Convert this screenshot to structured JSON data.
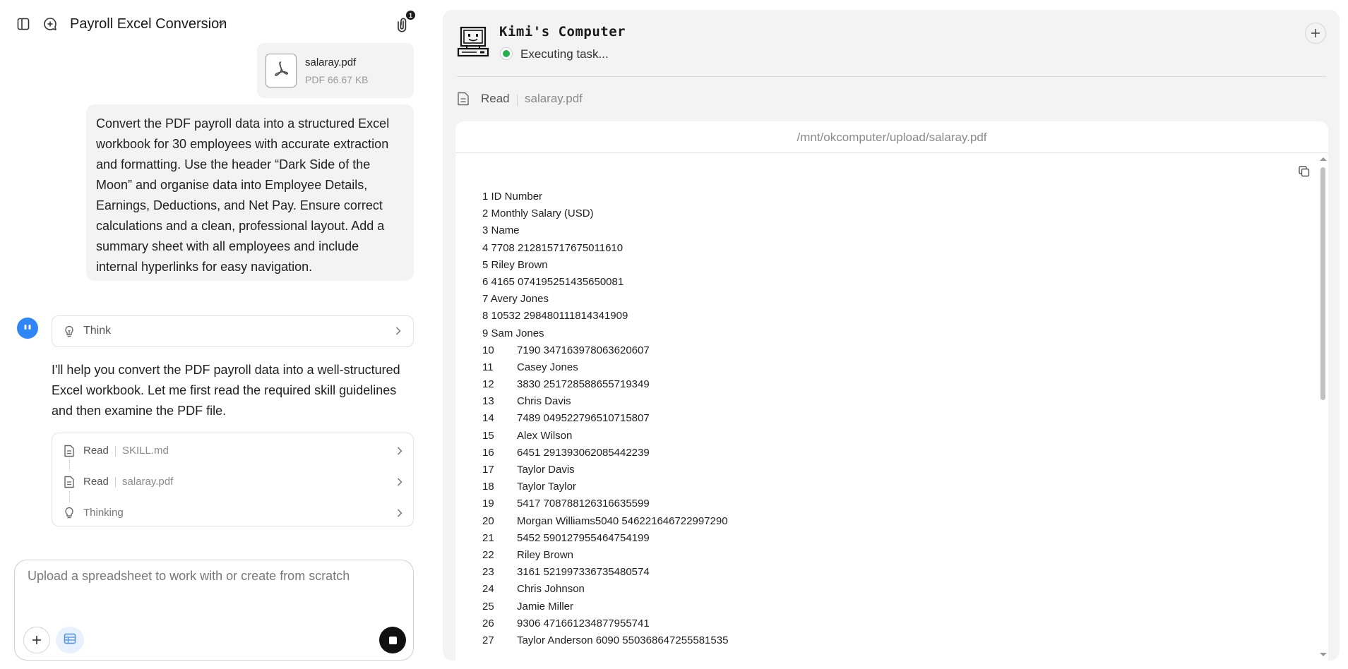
{
  "header": {
    "chat_title": "Payroll Excel Conversion",
    "attachment_count": "1"
  },
  "attachment": {
    "name": "salaray.pdf",
    "meta": "PDF 66.67 KB"
  },
  "user_message": "Convert the PDF payroll data into a structured Excel workbook for 30 employees with accurate extraction and formatting. Use the header “Dark Side of the Moon” and organise data into Employee Details, Earnings, Deductions, and Net Pay. Ensure correct calculations and a clean, professional layout. Add a summary sheet with all employees and include internal hyperlinks for easy navigation.",
  "think": {
    "label": "Think"
  },
  "assistant_message": "I'll help you convert the PDF payroll data into a well-structured Excel workbook. Let me first read the required skill guidelines and then examine the PDF file.",
  "steps": [
    {
      "label": "Read",
      "arg": "SKILL.md"
    },
    {
      "label": "Read",
      "arg": "salaray.pdf"
    },
    {
      "label": "Thinking",
      "arg": ""
    }
  ],
  "composer": {
    "placeholder": "Upload a spreadsheet to work with or create from scratch"
  },
  "computer": {
    "title": "Kimi's Computer",
    "status": "Executing task...",
    "status_color": "#22b24c"
  },
  "tool_call": {
    "label": "Read",
    "file": "salaray.pdf",
    "path": "/mnt/okcomputer/upload/salaray.pdf"
  },
  "file_lines": [
    {
      "n": "1",
      "text": "ID Number"
    },
    {
      "n": "2",
      "text": "Monthly Salary (USD)"
    },
    {
      "n": "3",
      "text": "Name"
    },
    {
      "n": "4",
      "text": "7708 212815717675011610"
    },
    {
      "n": "5",
      "text": "Riley Brown"
    },
    {
      "n": "6",
      "text": "4165 074195251435650081"
    },
    {
      "n": "7",
      "text": "Avery Jones"
    },
    {
      "n": "8",
      "text": "10532 298480111814341909"
    },
    {
      "n": "9",
      "text": "Sam Jones"
    },
    {
      "n": "10",
      "text": "7190 347163978063620607"
    },
    {
      "n": "11",
      "text": "Casey Jones"
    },
    {
      "n": "12",
      "text": "3830 251728588655719349"
    },
    {
      "n": "13",
      "text": "Chris Davis"
    },
    {
      "n": "14",
      "text": "7489 049522796510715807"
    },
    {
      "n": "15",
      "text": "Alex Wilson"
    },
    {
      "n": "16",
      "text": "6451 291393062085442239"
    },
    {
      "n": "17",
      "text": "Taylor Davis"
    },
    {
      "n": "18",
      "text": "Taylor Taylor"
    },
    {
      "n": "19",
      "text": "5417 708788126316635599"
    },
    {
      "n": "20",
      "text": "Morgan Williams5040 546221646722997290"
    },
    {
      "n": "21",
      "text": "5452 590127955464754199"
    },
    {
      "n": "22",
      "text": "Riley Brown"
    },
    {
      "n": "23",
      "text": "3161 521997336735480574"
    },
    {
      "n": "24",
      "text": "Chris Johnson"
    },
    {
      "n": "25",
      "text": "Jamie Miller"
    },
    {
      "n": "26",
      "text": "9306 471661234877955741"
    },
    {
      "n": "27",
      "text": "Taylor Anderson 6090 550368647255581535"
    }
  ]
}
